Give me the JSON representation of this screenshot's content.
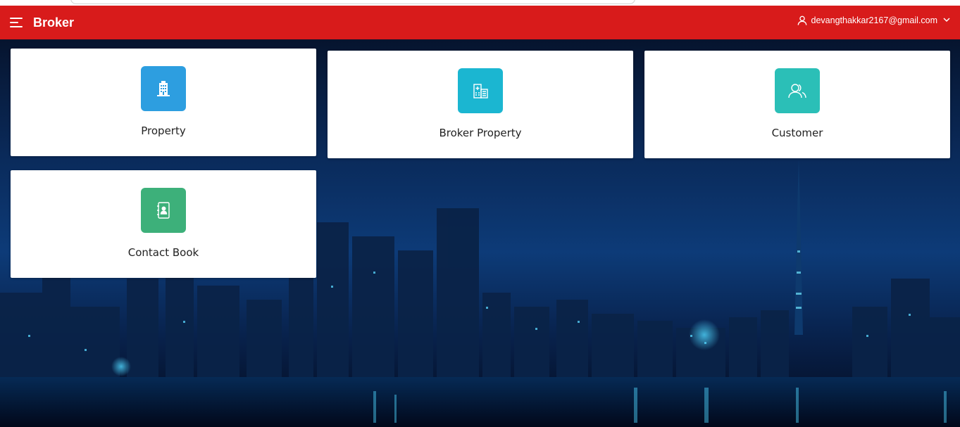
{
  "header": {
    "brand": "Broker",
    "user_email": "devangthakkar2167@gmail.com",
    "color": "#d81b1b"
  },
  "cards": [
    {
      "label": "Property",
      "icon": "building-icon",
      "color": "#2d9ee0"
    },
    {
      "label": "Broker Property",
      "icon": "office-building-icon",
      "color": "#1bb6d1"
    },
    {
      "label": "Customer",
      "icon": "users-icon",
      "color": "#2bbfb7"
    },
    {
      "label": "Contact Book",
      "icon": "contact-book-icon",
      "color": "#3db07a"
    }
  ]
}
